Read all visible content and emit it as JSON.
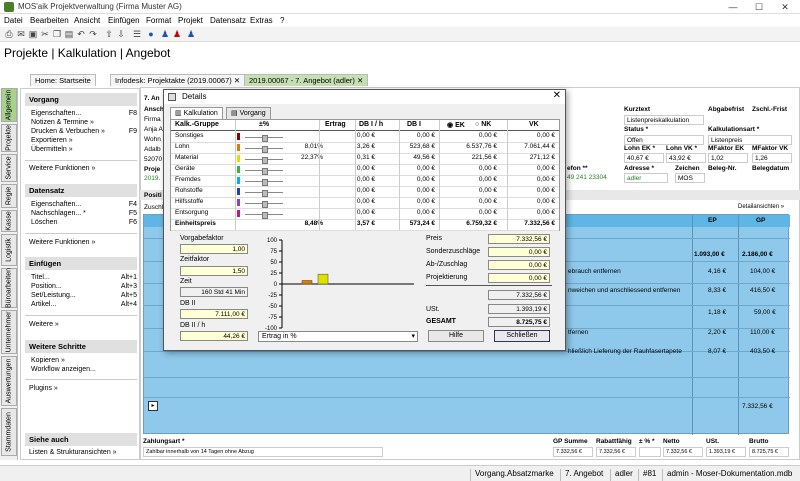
{
  "window": {
    "title": "MOS'aik Projektverwaltung (Firma Muster AG)"
  },
  "menu": [
    "Datei",
    "Bearbeiten",
    "Ansicht",
    "Einfügen",
    "Format",
    "Projekt",
    "Datensatz",
    "Extras",
    "?"
  ],
  "headline": "Projekte | Kalkulation | Angebot",
  "vtabs": [
    "Allgemein",
    "Projekte",
    "Service",
    "Regie",
    "Kasse",
    "Logistik",
    "Büroarbeiten",
    "Unternehmer",
    "Auswertungen",
    "Stammdaten"
  ],
  "leftpanel": {
    "vorgang": {
      "title": "Vorgang",
      "items": [
        {
          "label": "Eigenschaften...",
          "shortcut": "F8"
        },
        {
          "label": "Notizen & Termine »",
          "shortcut": ""
        },
        {
          "label": "Drucken & Verbuchen »",
          "shortcut": "F9"
        },
        {
          "label": "Exportieren »",
          "shortcut": ""
        },
        {
          "label": "Übermitteln »",
          "shortcut": ""
        }
      ],
      "more": "Weitere Funktionen »"
    },
    "datensatz": {
      "title": "Datensatz",
      "items": [
        {
          "label": "Eigenschaften...",
          "shortcut": "F4"
        },
        {
          "label": "Nachschlagen... *",
          "shortcut": "F5"
        },
        {
          "label": "Löschen",
          "shortcut": "F6"
        }
      ],
      "more": "Weitere Funktionen »"
    },
    "einfuegen": {
      "title": "Einfügen",
      "items": [
        {
          "label": "Titel...",
          "shortcut": "Alt+1"
        },
        {
          "label": "Position...",
          "shortcut": "Alt+3"
        },
        {
          "label": "Set/Leistung...",
          "shortcut": "Alt+5"
        },
        {
          "label": "Artikel...",
          "shortcut": "Alt+4"
        }
      ],
      "more": "Weitere »"
    },
    "schritte": {
      "title": "Weitere Schritte",
      "items": [
        {
          "label": "Kopieren »",
          "shortcut": ""
        },
        {
          "label": "Workflow anzeigen...",
          "shortcut": ""
        }
      ],
      "more": "Plugins »"
    },
    "siehe": {
      "title": "Siehe auch",
      "item": "Listen & Strukturansichten »"
    }
  },
  "doctabs": [
    "Home: Startseite",
    "Infodesk: Projektakte (2019.00067)",
    "2019.00067 - 7. Angebot (adler)"
  ],
  "header": {
    "section": "7. An",
    "ansch": "Ansch",
    "firma": "Firma",
    "anja": "Anja A",
    "wohn": "Wohn",
    "adal": "Adalb",
    "plz": "52070",
    "proj": "Proje",
    "projnr": "2019.",
    "kurztext_label": "Kurztext",
    "kurztext": "Listenpreiskalkulation",
    "abgabefrist_label": "Abgabefrist",
    "zschl_label": "Zschl.-Frist",
    "status_label": "Status *",
    "status": "Offen",
    "kalkart_label": "Kalkulationsart *",
    "kalkart": "Listenpreis",
    "lohnek_label": "Lohn EK *",
    "lohnek": "40,67 €",
    "lohnvk_label": "Lohn VK *",
    "lohnvk": "43,92 €",
    "mfek_label": "MFaktor EK",
    "mfek": "1,02",
    "mfvk_label": "MFaktor VK",
    "mfvk": "1,26",
    "telefon_label": "efon **",
    "telefon": "49 241 23304",
    "adresse_label": "Adresse *",
    "adresse": "adler",
    "zeichen_label": "Zeichen",
    "zeichen": "MOS",
    "belegnr_label": "Beleg-Nr.",
    "belegdatum_label": "Belegdatum"
  },
  "grid": {
    "posit": "Positi",
    "zusch": "Zuschl",
    "detail_link": "Detailansichten »",
    "col_ep": "EP",
    "col_gp": "GP",
    "rows": [
      {
        "text": "",
        "ep": "1.093,00 €",
        "gp": "2.186,00 €",
        "bold": true
      },
      {
        "text": "ebrauch entfernen",
        "ep": "4,16 €",
        "gp": "104,00 €",
        "bold": false
      },
      {
        "text": "nweichen und anschliessend entfernen",
        "ep": "8,33 €",
        "gp": "416,50 €",
        "bold": false
      },
      {
        "text": "",
        "ep": "1,18 €",
        "gp": "59,00 €",
        "bold": false
      },
      {
        "text": "tfernen",
        "ep": "2,20 €",
        "gp": "110,00 €",
        "bold": false
      },
      {
        "text": "hließlich Lieferung der Rauhfasertapete",
        "ep": "8,07 €",
        "gp": "403,50 €",
        "bold": false
      },
      {
        "text": "",
        "ep": "",
        "gp": "7.332,56 €",
        "bold": false
      }
    ]
  },
  "sums": {
    "zahlungsart_label": "Zahlungsart *",
    "zahlungsart": "Zahlbar innerhalb von 14 Tagen ohne Abzug",
    "gpsumme_label": "GP Summe",
    "gpsumme": "7.332,56 €",
    "rabatt_label": "Rabattfähig",
    "rabatt": "7.332,56 €",
    "proz_label": "± % *",
    "proz": "",
    "netto_label": "Netto",
    "netto": "7.332,56 €",
    "ust_label": "USt.",
    "ust": "1.393,19 €",
    "brutto_label": "Brutto",
    "brutto": "8.725,75 €"
  },
  "status": [
    "Vorgang.Absatzmarke",
    "7. Angebot",
    "adler",
    "#81",
    "admin - Moser-Dokumentation.mdb"
  ],
  "dialog": {
    "title": "Details",
    "tabs": [
      "Kalkulation",
      "Vorgang"
    ],
    "columns": [
      "Kalk.-Gruppe",
      "±%",
      "Ertrag",
      "DB I / h",
      "DB I",
      "EK",
      "NK",
      "VK"
    ],
    "rows": [
      {
        "name": "Sonstiges",
        "color": "#8B0000",
        "ertrag": "",
        "dbh": "0,00 €",
        "db": "0,00 €",
        "ek": "0,00 €",
        "vk": "0,00 €"
      },
      {
        "name": "Lohn",
        "color": "#e07b00",
        "ertrag": "8,01%",
        "dbh": "3,26 €",
        "db": "523,68 €",
        "ek": "6.537,76 €",
        "vk": "7.061,44 €"
      },
      {
        "name": "Material",
        "color": "#e0e000",
        "ertrag": "22,37%",
        "dbh": "0,31 €",
        "db": "49,56 €",
        "ek": "221,56 €",
        "vk": "271,12 €"
      },
      {
        "name": "Geräte",
        "color": "#3cb043",
        "ertrag": "",
        "dbh": "0,00 €",
        "db": "0,00 €",
        "ek": "0,00 €",
        "vk": "0,00 €"
      },
      {
        "name": "Fremdes",
        "color": "#00b0f0",
        "ertrag": "",
        "dbh": "0,00 €",
        "db": "0,00 €",
        "ek": "0,00 €",
        "vk": "0,00 €"
      },
      {
        "name": "Rohstoffe",
        "color": "#1f3fbf",
        "ertrag": "",
        "dbh": "0,00 €",
        "db": "0,00 €",
        "ek": "0,00 €",
        "vk": "0,00 €"
      },
      {
        "name": "Hilfsstoffe",
        "color": "#8e44ad",
        "ertrag": "",
        "dbh": "0,00 €",
        "db": "0,00 €",
        "ek": "0,00 €",
        "vk": "0,00 €"
      },
      {
        "name": "Entsorgung",
        "color": "#c71585",
        "ertrag": "",
        "dbh": "0,00 €",
        "db": "0,00 €",
        "ek": "0,00 €",
        "vk": "0,00 €"
      }
    ],
    "total": {
      "name": "Einheitspreis",
      "ertrag": "8,48%",
      "dbh": "3,57 €",
      "db": "573,24 €",
      "ek": "6.759,32 €",
      "vk": "7.332,56 €"
    },
    "vorgabefaktor_label": "Vorgabefaktor",
    "vorgabefaktor": "1,00",
    "zeitfaktor_label": "Zeitfaktor",
    "zeitfaktor": "1,50",
    "zeit_label": "Zeit",
    "zeit": "160 Std 41 Min",
    "db2_label": "DB II",
    "db2": "7.111,00 €",
    "db2h_label": "DB II / h",
    "db2h": "44,26 €",
    "chart_select": "Ertrag in %",
    "preis_label": "Preis",
    "preis": "7.332,56 €",
    "sonder_label": "Sonderzuschläge",
    "sonder": "0,00 €",
    "ababzug_label": "Ab-/Zuschlag",
    "ababzug": "0,00 €",
    "projektierung_label": "Projektierung",
    "projektierung": "0,00 €",
    "subtotal": "7.332,56 €",
    "ust_label": "USt.",
    "ust": "1.393,19 €",
    "gesamt_label": "GESAMT",
    "gesamt": "8.725,75 €",
    "hilfe": "Hilfe",
    "schliessen": "Schließen"
  },
  "chart_data": {
    "type": "bar",
    "categories": [
      "Sonstiges",
      "Lohn",
      "Material",
      "Geräte",
      "Fremdes",
      "Rohstoffe",
      "Hilfsstoffe",
      "Entsorgung"
    ],
    "values": [
      0,
      8.01,
      22.37,
      0,
      0,
      0,
      0,
      0
    ],
    "colors": [
      "#8B0000",
      "#e07b00",
      "#e0e000",
      "#3cb043",
      "#00b0f0",
      "#1f3fbf",
      "#8e44ad",
      "#c71585"
    ],
    "yticks": [
      "100",
      "75",
      "50",
      "25",
      "0",
      "-25",
      "-50",
      "-75",
      "-100"
    ],
    "ylim": [
      -100,
      100
    ],
    "title": "",
    "xlabel": "",
    "ylabel": ""
  }
}
